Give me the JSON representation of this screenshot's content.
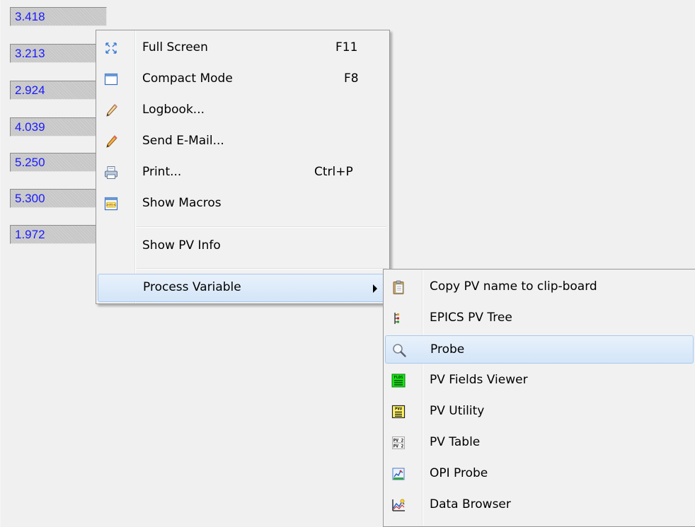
{
  "pv_values": [
    "3.418",
    "3.213",
    "2.924",
    "4.039",
    "5.250",
    "5.300",
    "1.972"
  ],
  "context_menu": {
    "items": [
      {
        "label": "Full Screen",
        "shortcut": "F11",
        "icon": "fullscreen-icon"
      },
      {
        "label": "Compact Mode",
        "shortcut": "F8",
        "icon": "window-icon"
      },
      {
        "label": "Logbook...",
        "icon": "pencil-icon"
      },
      {
        "label": "Send E-Mail...",
        "icon": "pencil-color-icon"
      },
      {
        "label": "Print...",
        "shortcut": "Ctrl+P",
        "icon": "printer-icon"
      },
      {
        "label": "Show Macros",
        "icon": "macros-icon"
      },
      {
        "label": "Show PV Info"
      },
      {
        "label": "Process Variable",
        "has_submenu": true
      }
    ]
  },
  "submenu": {
    "items": [
      {
        "label": "Copy PV name to clip-board",
        "icon": "clipboard-icon"
      },
      {
        "label": "EPICS PV Tree",
        "icon": "tree-icon"
      },
      {
        "label": "Probe",
        "icon": "magnifier-icon",
        "highlighted": true
      },
      {
        "label": "PV Fields Viewer",
        "icon": "fields-icon"
      },
      {
        "label": "PV Utility",
        "icon": "pvu-icon"
      },
      {
        "label": "PV Table",
        "icon": "pv-table-icon"
      },
      {
        "label": "OPI Probe",
        "icon": "opi-probe-icon"
      },
      {
        "label": "Data Browser",
        "icon": "data-browser-icon"
      }
    ]
  },
  "colors": {
    "value_text": "#1a1aff",
    "value_box": "#c7c7c7",
    "menu_bg": "#f1f1f1",
    "highlight": "#d3e5f8",
    "highlight_border": "#a9c9ee"
  }
}
